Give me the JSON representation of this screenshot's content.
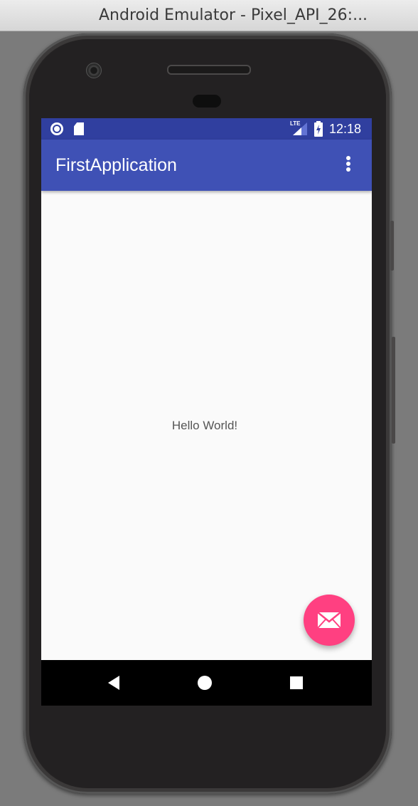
{
  "window": {
    "title": "Android Emulator - Pixel_API_26:..."
  },
  "status_bar": {
    "network_label": "LTE",
    "time": "12:18",
    "icons": [
      "circle-icon",
      "sd-card-icon",
      "signal-icon",
      "battery-icon"
    ]
  },
  "app_bar": {
    "title": "FirstApplication",
    "menu_icon": "more-vert-icon"
  },
  "content": {
    "text": "Hello World!"
  },
  "fab": {
    "icon": "email-icon"
  },
  "navigation": {
    "buttons": [
      "back-icon",
      "home-icon",
      "recents-icon"
    ]
  },
  "colors": {
    "status_bar": "#303f9f",
    "primary": "#3f51b5",
    "accent": "#ff4081",
    "background": "#fafafa"
  }
}
